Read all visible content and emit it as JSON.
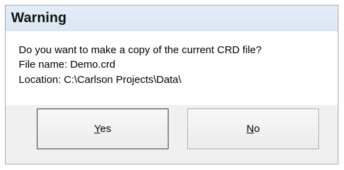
{
  "dialog": {
    "title": "Warning",
    "message_lines": [
      "Do you want to make a copy of the current CRD file?",
      "File name: Demo.crd",
      "Location: C:\\Carlson Projects\\Data\\"
    ],
    "buttons": {
      "yes": {
        "mnemonic": "Y",
        "rest": "es"
      },
      "no": {
        "mnemonic": "N",
        "rest": "o"
      }
    },
    "default_button": "yes"
  }
}
